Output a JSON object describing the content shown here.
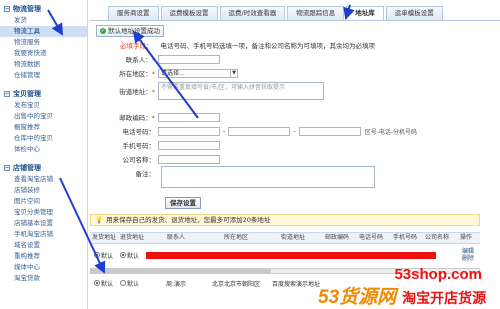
{
  "sidebar": {
    "groups": [
      {
        "title": "物流管理",
        "items": [
          "发货",
          "物流工具",
          "物流服务",
          "我要寄快递",
          "物流数据",
          "仓储管理"
        ],
        "active": 1
      },
      {
        "title": "宝贝管理",
        "items": [
          "发布宝贝",
          "出售中的宝贝",
          "橱窗推荐",
          "仓库中的宝贝",
          "体检中心"
        ],
        "active": -1
      },
      {
        "title": "店铺管理",
        "items": [
          "查看淘宝店铺",
          "店铺装修",
          "图片空间",
          "宝贝分类管理",
          "店铺基本设置",
          "手机淘宝店铺",
          "域名设置",
          "重构推荐",
          "媒体中心",
          "淘宝贷款"
        ],
        "active": -1
      }
    ]
  },
  "tabs": [
    "服务商设置",
    "运费模板设置",
    "运费/时效查看器",
    "物流跟踪信息",
    "地址库",
    "运单模板设置"
  ],
  "active_tab": 4,
  "set_default_label": "默认地址设置成功",
  "tip": {
    "required": "必填字段：",
    "text": "电话号码、手机号码选填一项，备注和公司名称为可填项，其余均为必填项"
  },
  "form": {
    "contact_label": "联系人：",
    "region_label": "所在地区：",
    "region_value": "请选择...",
    "street_label": "街道地址：",
    "street_placeholder": "不需要重复填写省/市/区，可输入拼音获取提示",
    "zip_label": "邮政编码：",
    "phone_label": "电话号码：",
    "phone_hint": "区号-电话-分机号码",
    "mobile_label": "手机号码：",
    "company_label": "公司名称：",
    "remark_label": "备注：",
    "save_label": "保存设置"
  },
  "saved_tip": "用来保存自己的发货、退货地址，您最多可添加20条地址",
  "table": {
    "headers": [
      "发货地址",
      "退货地址",
      "联系人",
      "所在地区",
      "街道地址",
      "邮政编码",
      "电话号码",
      "手机号码",
      "公司名称",
      "操作"
    ],
    "rows": [
      {
        "ship": "默认",
        "return": "默认",
        "contact": "",
        "region": "",
        "street": "",
        "zip": "",
        "phone": "",
        "mobile": "",
        "company": "",
        "ops": [
          "编辑",
          "删除"
        ]
      },
      {
        "ship": "默认",
        "return": "默认",
        "contact": "周:演示",
        "region": "北京北京市朝阳区",
        "street": "百度搜索演示地址",
        "zip": "",
        "phone": "",
        "mobile": "",
        "company": "",
        "ops": []
      }
    ]
  },
  "watermark": {
    "url": "53shop.com",
    "brand": "53货源网",
    "slogan": "淘宝开店货源"
  },
  "colors": {
    "accent": "#1b4e8b",
    "red": "#e11111",
    "watermark_orange": "#f08a00"
  }
}
